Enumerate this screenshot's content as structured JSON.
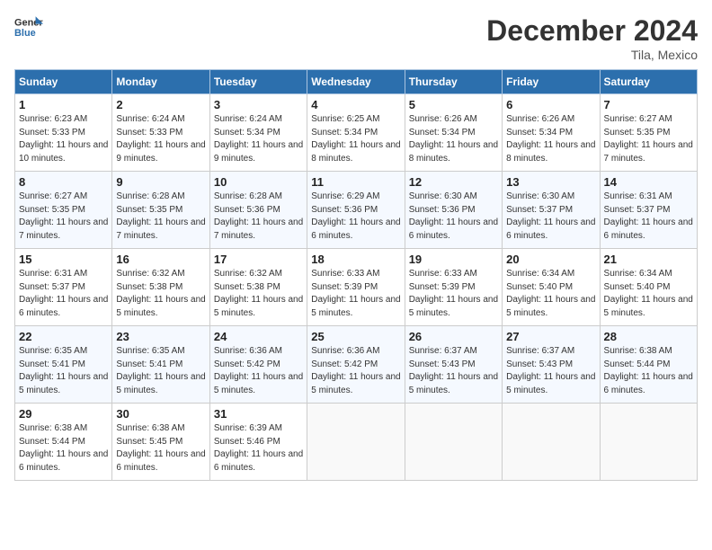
{
  "header": {
    "logo_general": "General",
    "logo_blue": "Blue",
    "month_title": "December 2024",
    "location": "Tila, Mexico"
  },
  "weekdays": [
    "Sunday",
    "Monday",
    "Tuesday",
    "Wednesday",
    "Thursday",
    "Friday",
    "Saturday"
  ],
  "weeks": [
    [
      {
        "day": "1",
        "sunrise": "6:23 AM",
        "sunset": "5:33 PM",
        "daylight": "11 hours and 10 minutes."
      },
      {
        "day": "2",
        "sunrise": "6:24 AM",
        "sunset": "5:33 PM",
        "daylight": "11 hours and 9 minutes."
      },
      {
        "day": "3",
        "sunrise": "6:24 AM",
        "sunset": "5:34 PM",
        "daylight": "11 hours and 9 minutes."
      },
      {
        "day": "4",
        "sunrise": "6:25 AM",
        "sunset": "5:34 PM",
        "daylight": "11 hours and 8 minutes."
      },
      {
        "day": "5",
        "sunrise": "6:26 AM",
        "sunset": "5:34 PM",
        "daylight": "11 hours and 8 minutes."
      },
      {
        "day": "6",
        "sunrise": "6:26 AM",
        "sunset": "5:34 PM",
        "daylight": "11 hours and 8 minutes."
      },
      {
        "day": "7",
        "sunrise": "6:27 AM",
        "sunset": "5:35 PM",
        "daylight": "11 hours and 7 minutes."
      }
    ],
    [
      {
        "day": "8",
        "sunrise": "6:27 AM",
        "sunset": "5:35 PM",
        "daylight": "11 hours and 7 minutes."
      },
      {
        "day": "9",
        "sunrise": "6:28 AM",
        "sunset": "5:35 PM",
        "daylight": "11 hours and 7 minutes."
      },
      {
        "day": "10",
        "sunrise": "6:28 AM",
        "sunset": "5:36 PM",
        "daylight": "11 hours and 7 minutes."
      },
      {
        "day": "11",
        "sunrise": "6:29 AM",
        "sunset": "5:36 PM",
        "daylight": "11 hours and 6 minutes."
      },
      {
        "day": "12",
        "sunrise": "6:30 AM",
        "sunset": "5:36 PM",
        "daylight": "11 hours and 6 minutes."
      },
      {
        "day": "13",
        "sunrise": "6:30 AM",
        "sunset": "5:37 PM",
        "daylight": "11 hours and 6 minutes."
      },
      {
        "day": "14",
        "sunrise": "6:31 AM",
        "sunset": "5:37 PM",
        "daylight": "11 hours and 6 minutes."
      }
    ],
    [
      {
        "day": "15",
        "sunrise": "6:31 AM",
        "sunset": "5:37 PM",
        "daylight": "11 hours and 6 minutes."
      },
      {
        "day": "16",
        "sunrise": "6:32 AM",
        "sunset": "5:38 PM",
        "daylight": "11 hours and 5 minutes."
      },
      {
        "day": "17",
        "sunrise": "6:32 AM",
        "sunset": "5:38 PM",
        "daylight": "11 hours and 5 minutes."
      },
      {
        "day": "18",
        "sunrise": "6:33 AM",
        "sunset": "5:39 PM",
        "daylight": "11 hours and 5 minutes."
      },
      {
        "day": "19",
        "sunrise": "6:33 AM",
        "sunset": "5:39 PM",
        "daylight": "11 hours and 5 minutes."
      },
      {
        "day": "20",
        "sunrise": "6:34 AM",
        "sunset": "5:40 PM",
        "daylight": "11 hours and 5 minutes."
      },
      {
        "day": "21",
        "sunrise": "6:34 AM",
        "sunset": "5:40 PM",
        "daylight": "11 hours and 5 minutes."
      }
    ],
    [
      {
        "day": "22",
        "sunrise": "6:35 AM",
        "sunset": "5:41 PM",
        "daylight": "11 hours and 5 minutes."
      },
      {
        "day": "23",
        "sunrise": "6:35 AM",
        "sunset": "5:41 PM",
        "daylight": "11 hours and 5 minutes."
      },
      {
        "day": "24",
        "sunrise": "6:36 AM",
        "sunset": "5:42 PM",
        "daylight": "11 hours and 5 minutes."
      },
      {
        "day": "25",
        "sunrise": "6:36 AM",
        "sunset": "5:42 PM",
        "daylight": "11 hours and 5 minutes."
      },
      {
        "day": "26",
        "sunrise": "6:37 AM",
        "sunset": "5:43 PM",
        "daylight": "11 hours and 5 minutes."
      },
      {
        "day": "27",
        "sunrise": "6:37 AM",
        "sunset": "5:43 PM",
        "daylight": "11 hours and 5 minutes."
      },
      {
        "day": "28",
        "sunrise": "6:38 AM",
        "sunset": "5:44 PM",
        "daylight": "11 hours and 6 minutes."
      }
    ],
    [
      {
        "day": "29",
        "sunrise": "6:38 AM",
        "sunset": "5:44 PM",
        "daylight": "11 hours and 6 minutes."
      },
      {
        "day": "30",
        "sunrise": "6:38 AM",
        "sunset": "5:45 PM",
        "daylight": "11 hours and 6 minutes."
      },
      {
        "day": "31",
        "sunrise": "6:39 AM",
        "sunset": "5:46 PM",
        "daylight": "11 hours and 6 minutes."
      },
      null,
      null,
      null,
      null
    ]
  ],
  "labels": {
    "sunrise": "Sunrise:",
    "sunset": "Sunset:",
    "daylight": "Daylight:"
  }
}
